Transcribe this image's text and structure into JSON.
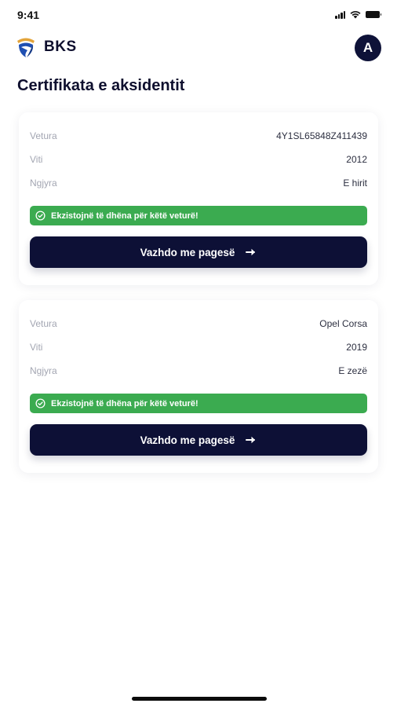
{
  "status_bar": {
    "time": "9:41",
    "icons": [
      "cellular-signal-icon",
      "wifi-icon",
      "battery-icon"
    ]
  },
  "header": {
    "logo_text": "BKS",
    "avatar_initial": "A"
  },
  "page_title": "Certifikata e aksidentit",
  "colors": {
    "primary": "#0d1036",
    "success": "#3bab50",
    "logo_blue": "#1f4fb2",
    "logo_gold": "#e3a43a"
  },
  "cards": [
    {
      "rows": [
        {
          "label": "Vetura",
          "value": "4Y1SL65848Z411439"
        },
        {
          "label": "Viti",
          "value": "2012"
        },
        {
          "label": "Ngjyra",
          "value": "E hirit"
        }
      ],
      "alert": "Ekzistojnë të dhëna për këtë veturë!",
      "button": "Vazhdo me pagesë"
    },
    {
      "rows": [
        {
          "label": "Vetura",
          "value": "Opel Corsa"
        },
        {
          "label": "Viti",
          "value": "2019"
        },
        {
          "label": "Ngjyra",
          "value": "E zezë"
        }
      ],
      "alert": "Ekzistojnë të dhëna për këtë veturë!",
      "button": "Vazhdo me pagesë"
    }
  ]
}
